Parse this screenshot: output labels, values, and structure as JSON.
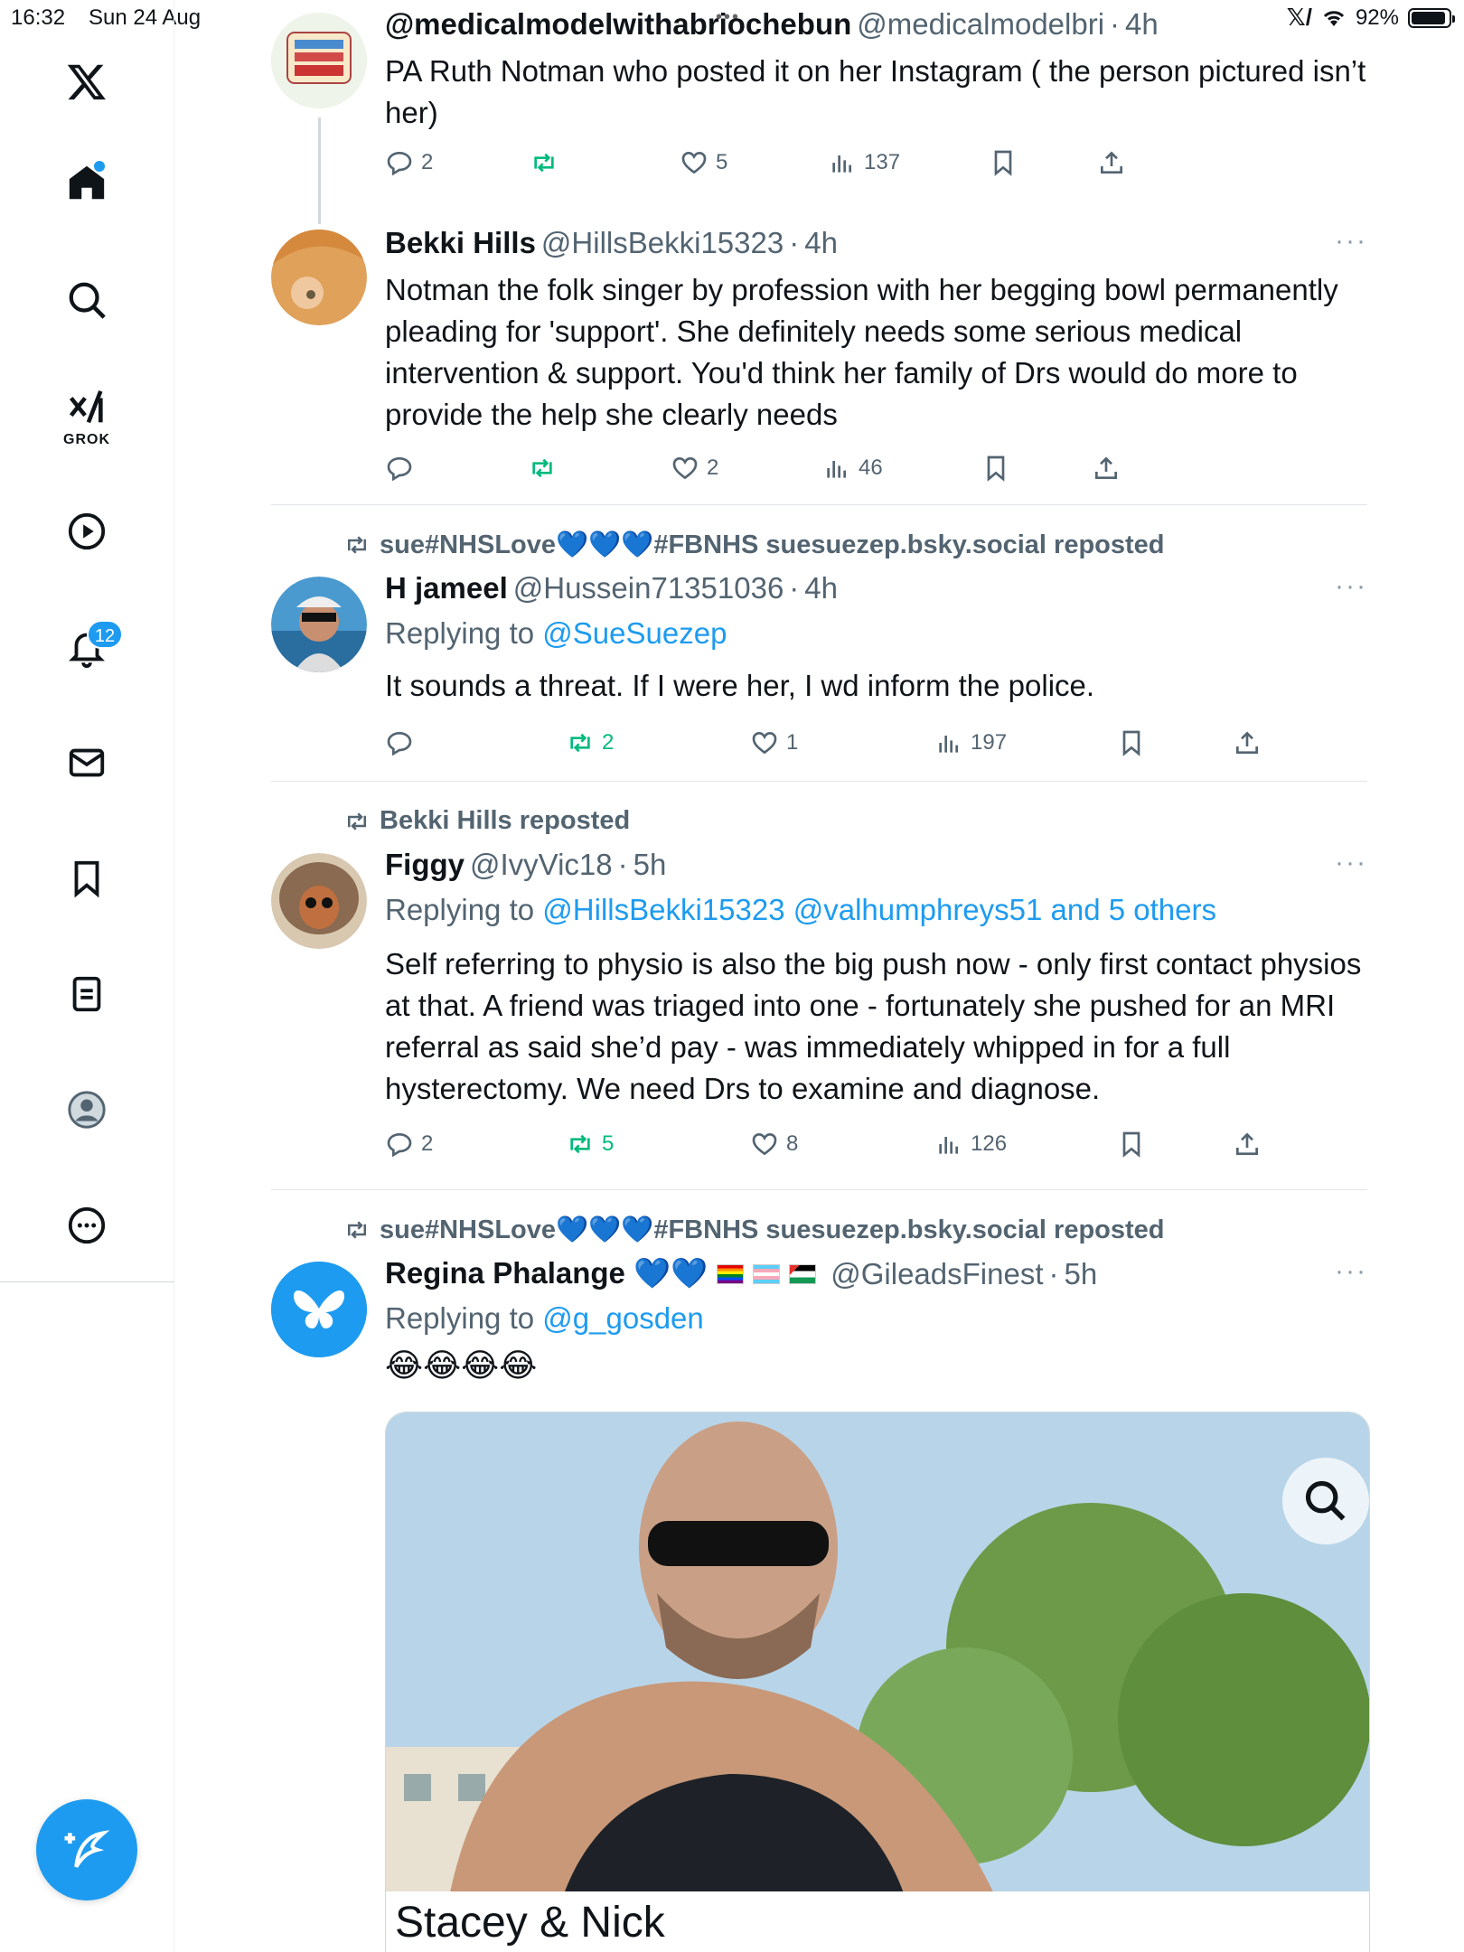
{
  "status_bar": {
    "time": "16:32",
    "date": "Sun 24 Aug",
    "battery": "92%",
    "battery_level": 0.92
  },
  "sidebar": {
    "items": [
      {
        "name": "x-logo-icon"
      },
      {
        "name": "home-icon"
      },
      {
        "name": "search-icon"
      },
      {
        "name": "grok-icon",
        "label": "GROK"
      },
      {
        "name": "video-icon"
      },
      {
        "name": "notifications-icon",
        "badge": "12"
      },
      {
        "name": "messages-icon"
      },
      {
        "name": "bookmarks-icon"
      },
      {
        "name": "lists-icon"
      },
      {
        "name": "profile-icon"
      },
      {
        "name": "more-icon"
      }
    ],
    "compose_icon": "compose-icon"
  },
  "accent_color": "#1d9bf0",
  "repost_color": "#00ba7c",
  "posts": [
    {
      "name": "@medicalmodelwithabriochebun",
      "handle": "@medicalmodelbri",
      "time": "4h",
      "text": "PA Ruth Notman who posted it on her Instagram ( the person pictured isn’t her)",
      "replies": "2",
      "reposts": "",
      "likes": "5",
      "views": "137"
    },
    {
      "name": "Bekki Hills",
      "handle": "@HillsBekki15323",
      "time": "4h",
      "text": "Notman the folk singer by profession with her begging bowl permanently pleading for 'support'. She definitely needs some serious medical intervention & support. You'd think her family of Drs would do more to provide the help she clearly needs",
      "replies": "",
      "reposts": "",
      "likes": "2",
      "views": "46",
      "more": "···"
    },
    {
      "repost_by": "sue#NHSLove💙💙💙#FBNHS suesuezep.bsky.social reposted",
      "name": "H jameel",
      "handle": "@Hussein71351036",
      "time": "4h",
      "replying_label": "Replying to",
      "replying_to": "@SueSuezep",
      "text": "It sounds a threat. If I were her,  I wd inform the police.",
      "replies": "",
      "reposts": "2",
      "likes": "1",
      "views": "197",
      "more": "···"
    },
    {
      "repost_by": "Bekki Hills reposted",
      "name": "Figgy",
      "handle": "@IvyVic18",
      "time": "5h",
      "replying_label": "Replying to",
      "replying_to": "@HillsBekki15323 @valhumphreys51 and 5 others",
      "text": "Self referring to physio is also the big push now - only first contact physios at that. A friend was triaged into one - fortunately she pushed for an MRI referral as said she’d pay - was immediately whipped in for a full hysterectomy. We need Drs to examine and diagnose.",
      "replies": "2",
      "reposts": "5",
      "likes": "8",
      "views": "126",
      "more": "···"
    },
    {
      "repost_by": "sue#NHSLove💙💙💙#FBNHS suesuezep.bsky.social reposted",
      "name": "Regina Phalange 💙💙",
      "handle": "@GileadsFinest",
      "time": "5h",
      "replying_label": "Replying to",
      "replying_to": "@g_gosden",
      "text": "😂😂😂😂",
      "media_caption": "Stacey & Nick",
      "more": "···"
    }
  ]
}
